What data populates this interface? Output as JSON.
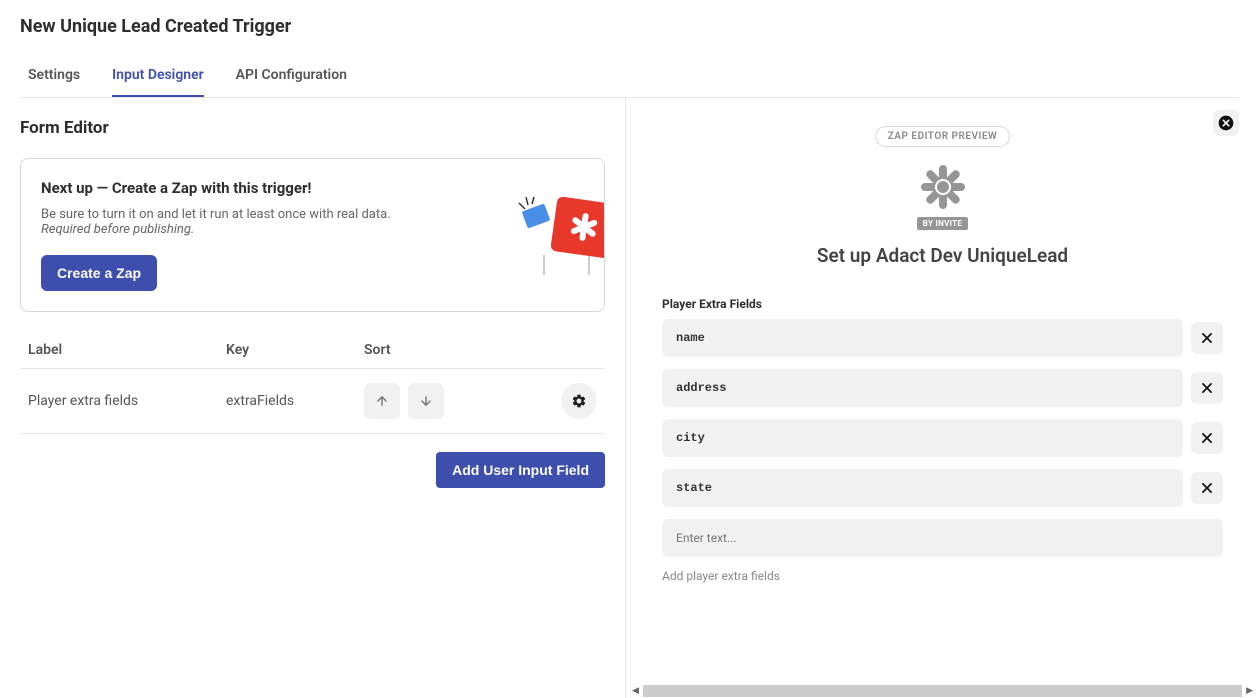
{
  "header": {
    "title": "New Unique Lead Created Trigger"
  },
  "tabs": [
    {
      "label": "Settings",
      "active": false
    },
    {
      "label": "Input Designer",
      "active": true
    },
    {
      "label": "API Configuration",
      "active": false
    }
  ],
  "formEditor": {
    "title": "Form Editor",
    "card": {
      "title": "Next up — Create a Zap with this trigger!",
      "body": "Be sure to turn it on and let it run at least once with real data.",
      "bodyItalic": "Required before publishing.",
      "button": "Create a Zap"
    },
    "table": {
      "headers": {
        "label": "Label",
        "key": "Key",
        "sort": "Sort"
      },
      "row": {
        "label": "Player extra fields",
        "key": "extraFields"
      }
    },
    "addButton": "Add User Input Field"
  },
  "preview": {
    "badge": "ZAP EDITOR PREVIEW",
    "inviteBadge": "BY INVITE",
    "title": "Set up Adact Dev UniqueLead",
    "fieldLabel": "Player Extra Fields",
    "fields": [
      "name",
      "address",
      "city",
      "state"
    ],
    "placeholder": "Enter text...",
    "addHint": "Add player extra fields"
  }
}
